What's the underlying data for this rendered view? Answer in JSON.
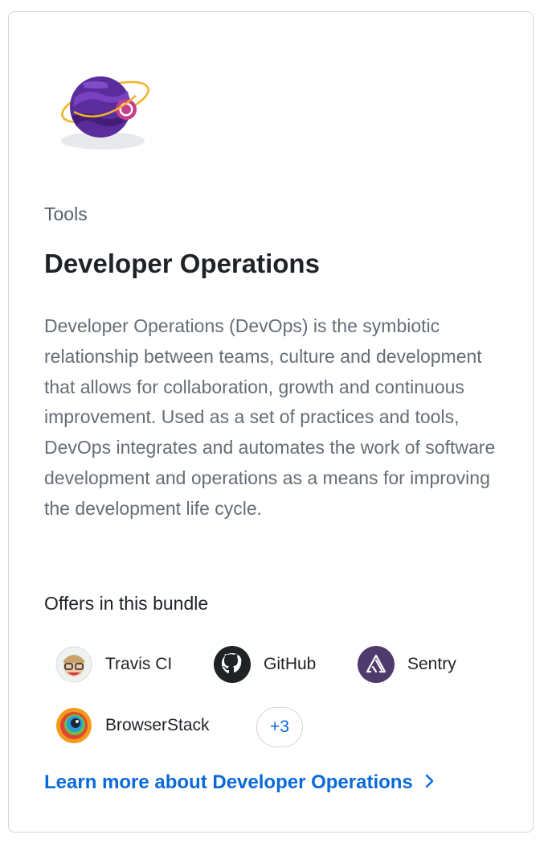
{
  "card": {
    "category": "Tools",
    "title": "Developer Operations",
    "description": "Developer Operations (DevOps) is the symbiotic relationship between teams, culture and development that allows for collaboration, growth and continuous improvement. Used as a set of practices and tools, DevOps integrates and automates the work of software development and operations as a means for improving the development life cycle.",
    "offers_heading": "Offers in this bundle",
    "offers": [
      {
        "name": "Travis CI",
        "icon": "travis-ci-logo-icon"
      },
      {
        "name": "GitHub",
        "icon": "github-logo-icon"
      },
      {
        "name": "Sentry",
        "icon": "sentry-logo-icon"
      },
      {
        "name": "BrowserStack",
        "icon": "browserstack-logo-icon"
      }
    ],
    "more_count": "+3",
    "learn_more": "Learn more about Developer Operations",
    "hero_icon": "planet-github-icon",
    "colors": {
      "link": "#0969da",
      "text": "#1f2328",
      "muted": "#656d76",
      "border": "#d0d7de"
    }
  }
}
